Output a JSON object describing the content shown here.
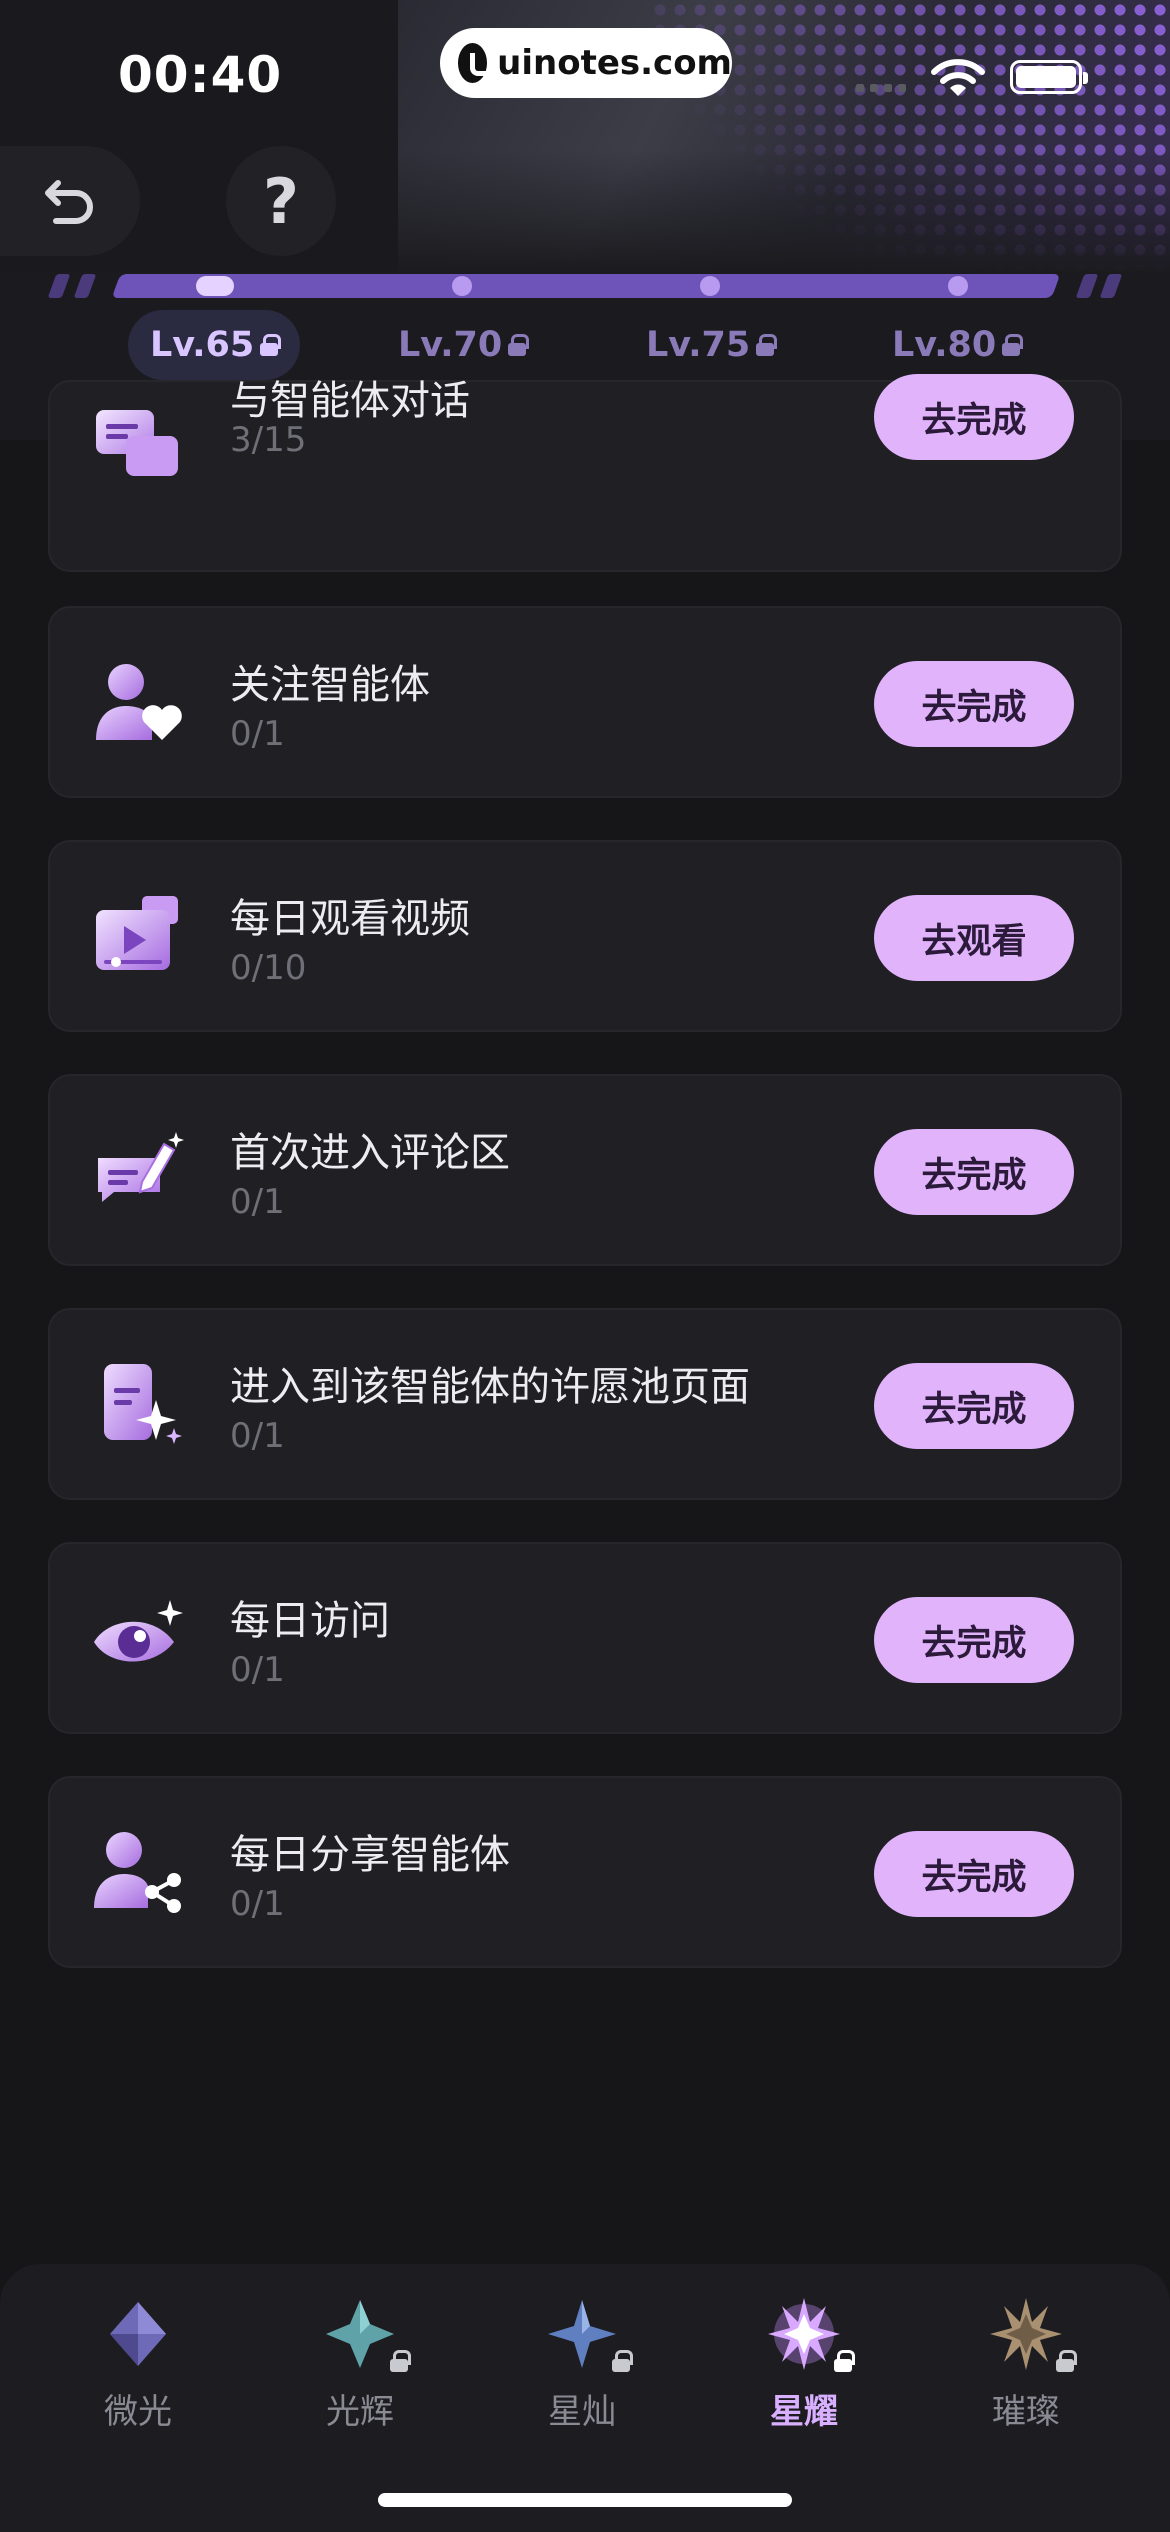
{
  "status_bar": {
    "time": "00:40",
    "watermark": "uinotes.com"
  },
  "header": {
    "back_icon": "undo-icon",
    "help_label": "?",
    "levels": [
      {
        "label": "Lv.65",
        "active": true
      },
      {
        "label": "Lv.70",
        "active": false
      },
      {
        "label": "Lv.75",
        "active": false
      },
      {
        "label": "Lv.80",
        "active": false
      }
    ]
  },
  "tasks": [
    {
      "title": "与智能体对话",
      "count": "3/15",
      "action": "去完成",
      "icon": "chat-bubbles-icon"
    },
    {
      "title": "关注智能体",
      "count": "0/1",
      "action": "去完成",
      "icon": "user-heart-icon"
    },
    {
      "title": "每日观看视频",
      "count": "0/10",
      "action": "去观看",
      "icon": "video-play-icon"
    },
    {
      "title": "首次进入评论区",
      "count": "0/1",
      "action": "去完成",
      "icon": "comment-pen-icon"
    },
    {
      "title": "进入到该智能体的许愿池页面",
      "count": "0/1",
      "action": "去完成",
      "icon": "phone-sparkle-icon"
    },
    {
      "title": "每日访问",
      "count": "0/1",
      "action": "去完成",
      "icon": "eye-sparkle-icon"
    },
    {
      "title": "每日分享智能体",
      "count": "0/1",
      "action": "去完成",
      "icon": "user-share-icon"
    }
  ],
  "tiers": [
    {
      "name": "微光",
      "locked": false,
      "active": false,
      "color": "#6f6ab8"
    },
    {
      "name": "光辉",
      "locked": true,
      "active": false,
      "color": "#5fa3a8"
    },
    {
      "name": "星灿",
      "locked": true,
      "active": false,
      "color": "#5f7fc0"
    },
    {
      "name": "星耀",
      "locked": true,
      "active": true,
      "color": "#c68cff"
    },
    {
      "name": "璀璨",
      "locked": true,
      "active": false,
      "color": "#a89070"
    }
  ],
  "colors": {
    "accent": "#e0b3fb",
    "progress": "#6e54b8",
    "card": "#202024",
    "background": "#161619"
  }
}
